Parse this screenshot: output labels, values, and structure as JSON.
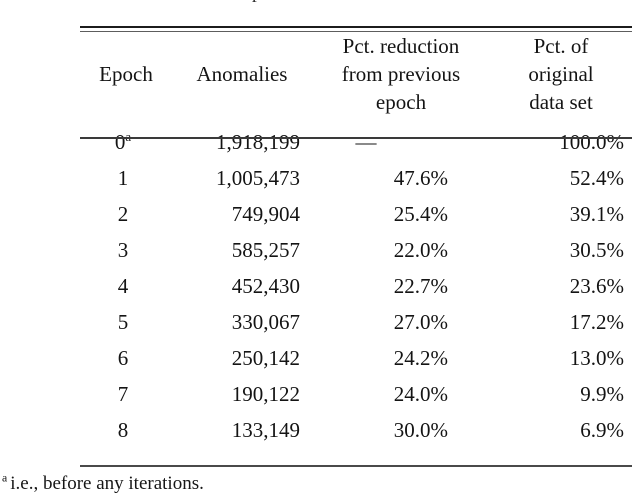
{
  "caption_fragment": "p",
  "table": {
    "columns": [
      {
        "key": "epoch",
        "header_lines": [
          "",
          "Epoch",
          ""
        ],
        "align": "center"
      },
      {
        "key": "anomalies",
        "header_lines": [
          "",
          "Anomalies",
          ""
        ],
        "align": "right"
      },
      {
        "key": "reduction",
        "header_lines": [
          "Pct. reduction",
          "from previous",
          "epoch"
        ],
        "align": "right"
      },
      {
        "key": "original",
        "header_lines": [
          "Pct. of",
          "original",
          "data set"
        ],
        "align": "right"
      }
    ],
    "header_flat": {
      "epoch": "Epoch",
      "anomalies": "Anomalies",
      "reduction": "Pct. reduction from previous epoch",
      "original": "Pct. of original data set"
    },
    "rows": [
      {
        "epoch": "0",
        "epoch_superscript": "a",
        "anomalies": "1,918,199",
        "reduction": "—",
        "original": "100.0%"
      },
      {
        "epoch": "1",
        "epoch_superscript": "",
        "anomalies": "1,005,473",
        "reduction": "47.6%",
        "original": "52.4%"
      },
      {
        "epoch": "2",
        "epoch_superscript": "",
        "anomalies": "749,904",
        "reduction": "25.4%",
        "original": "39.1%"
      },
      {
        "epoch": "3",
        "epoch_superscript": "",
        "anomalies": "585,257",
        "reduction": "22.0%",
        "original": "30.5%"
      },
      {
        "epoch": "4",
        "epoch_superscript": "",
        "anomalies": "452,430",
        "reduction": "22.7%",
        "original": "23.6%"
      },
      {
        "epoch": "5",
        "epoch_superscript": "",
        "anomalies": "330,067",
        "reduction": "27.0%",
        "original": "17.2%"
      },
      {
        "epoch": "6",
        "epoch_superscript": "",
        "anomalies": "250,142",
        "reduction": "24.2%",
        "original": "13.0%"
      },
      {
        "epoch": "7",
        "epoch_superscript": "",
        "anomalies": "190,122",
        "reduction": "24.0%",
        "original": "9.9%"
      },
      {
        "epoch": "8",
        "epoch_superscript": "",
        "anomalies": "133,149",
        "reduction": "30.0%",
        "original": "6.9%"
      }
    ]
  },
  "footnote": {
    "marker": "a",
    "text": "i.e., before any iterations."
  },
  "colors": {
    "text": "#141414",
    "rule_dark": "#1c1c1c",
    "rule_light": "#5d5d5d",
    "background": "#ffffff"
  }
}
